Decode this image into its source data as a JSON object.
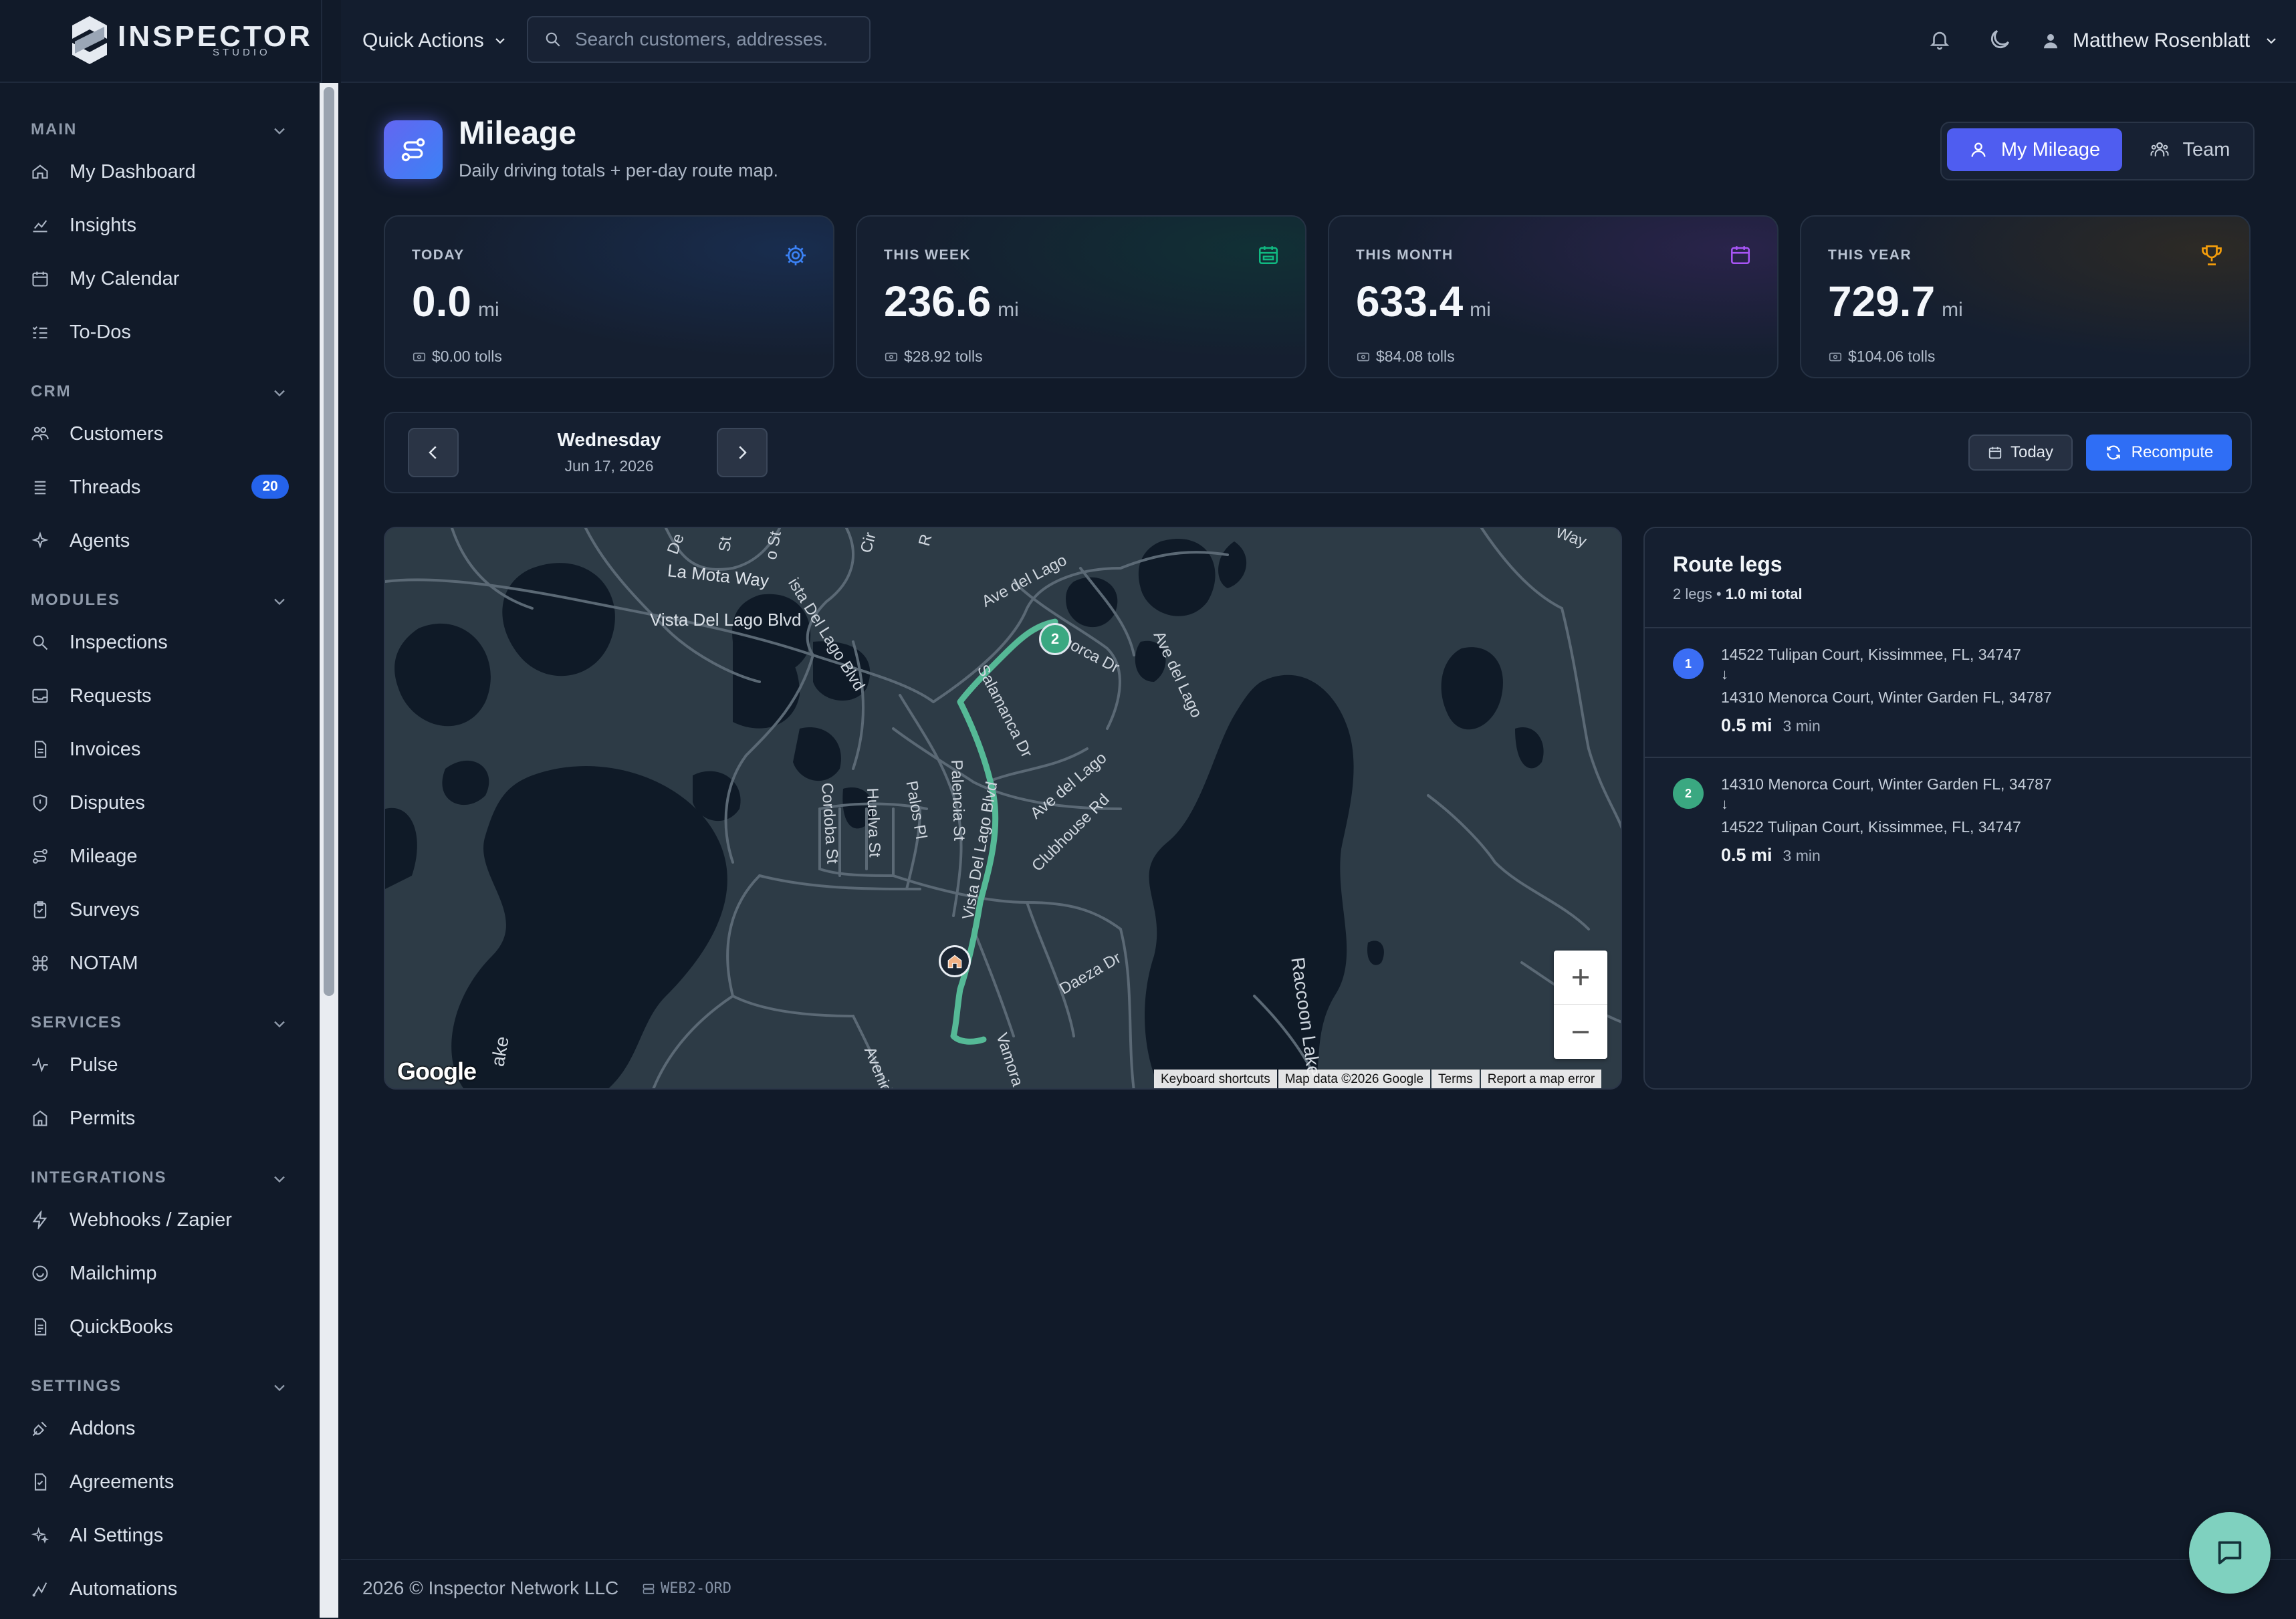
{
  "brand": {
    "name": "INSPECTOR",
    "sub": "STUDIO"
  },
  "topbar": {
    "quick_actions": "Quick Actions",
    "search_placeholder": "Search customers, addresses.",
    "user_name": "Matthew Rosenblatt"
  },
  "sidebar": {
    "sections": [
      {
        "label": "MAIN",
        "items": [
          "My Dashboard",
          "Insights",
          "My Calendar",
          "To-Dos"
        ]
      },
      {
        "label": "CRM",
        "items": [
          "Customers",
          "Threads",
          "Agents"
        ]
      },
      {
        "label": "MODULES",
        "items": [
          "Inspections",
          "Requests",
          "Invoices",
          "Disputes",
          "Mileage",
          "Surveys",
          "NOTAM"
        ]
      },
      {
        "label": "SERVICES",
        "items": [
          "Pulse",
          "Permits"
        ]
      },
      {
        "label": "INTEGRATIONS",
        "items": [
          "Webhooks / Zapier",
          "Mailchimp",
          "QuickBooks"
        ]
      },
      {
        "label": "SETTINGS",
        "items": [
          "Addons",
          "Agreements",
          "AI Settings",
          "Automations"
        ]
      }
    ],
    "threads_badge": "20"
  },
  "page": {
    "title": "Mileage",
    "subtitle": "Daily driving totals + per-day route map.",
    "toggle": {
      "mine": "My Mileage",
      "team": "Team",
      "active": "mine"
    }
  },
  "stats": [
    {
      "label": "TODAY",
      "value": "0.0",
      "unit": "mi",
      "tolls": "$0.00 tolls",
      "icon": "gear-icon",
      "color": "#3b82f6"
    },
    {
      "label": "THIS WEEK",
      "value": "236.6",
      "unit": "mi",
      "tolls": "$28.92 tolls",
      "icon": "calendar-week-icon",
      "color": "#10b981"
    },
    {
      "label": "THIS MONTH",
      "value": "633.4",
      "unit": "mi",
      "tolls": "$84.08 tolls",
      "icon": "calendar-icon",
      "color": "#a855f7"
    },
    {
      "label": "THIS YEAR",
      "value": "729.7",
      "unit": "mi",
      "tolls": "$104.06 tolls",
      "icon": "trophy-icon",
      "color": "#f59e0b"
    }
  ],
  "day": {
    "weekday": "Wednesday",
    "date": "Jun 17, 2026",
    "today_label": "Today",
    "recompute_label": "Recompute"
  },
  "map": {
    "street_labels": [
      "De",
      "St",
      "o St",
      "Cir",
      "R",
      "La Mota Way",
      "Vista Del Lago Blvd",
      "ista Del Lago Blvd",
      "Ave del Lago",
      "Menorca Dr",
      "Ave del Lago",
      "Salamanca Dr",
      "Ave del Lago",
      "Clubhouse Rd",
      "Cordoba St",
      "Huelva St",
      "Palos Pl",
      "Palencia St",
      "Vista Del Lago Blvd",
      "Daeza Dr",
      "Raccoon Lake",
      "Vamora",
      "Avenid",
      "ake",
      "Way"
    ],
    "marker_label": "2",
    "google": "Google",
    "attribution": [
      "Keyboard shortcuts",
      "Map data ©2026 Google",
      "Terms",
      "Report a map error"
    ]
  },
  "route_legs": {
    "title": "Route legs",
    "count_text": "2 legs",
    "total_text": "1.0 mi total",
    "legs": [
      {
        "num": "1",
        "from": "14522 Tulipan Court, Kissimmee, FL, 34747",
        "to": "14310 Menorca Court, Winter Garden FL, 34787",
        "miles": "0.5 mi",
        "minutes": "3 min",
        "color": "#3b6ef5"
      },
      {
        "num": "2",
        "from": "14310 Menorca Court, Winter Garden FL, 34787",
        "to": "14522 Tulipan Court, Kissimmee, FL, 34747",
        "miles": "0.5 mi",
        "minutes": "3 min",
        "color": "#3aa881"
      }
    ]
  },
  "footer": {
    "copyright": "2026 © Inspector Network LLC",
    "server": "WEB2-ORD"
  }
}
